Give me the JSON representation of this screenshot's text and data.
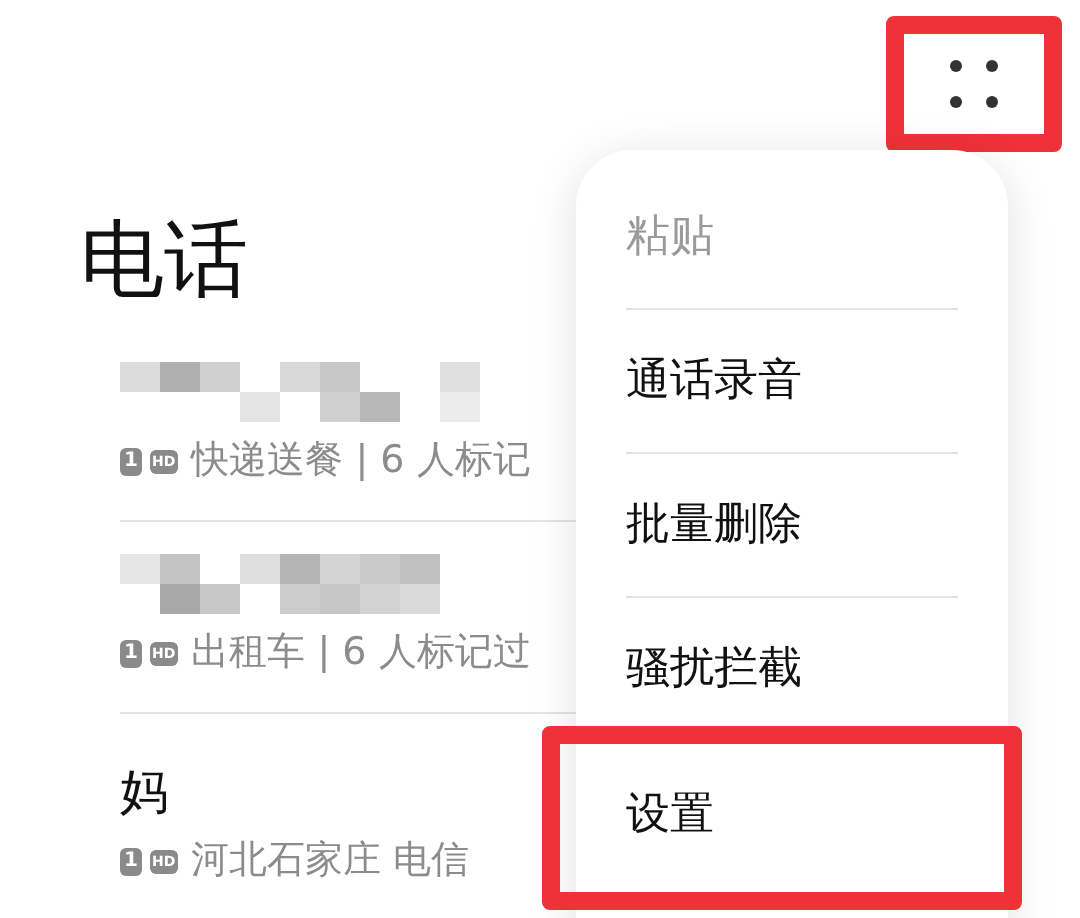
{
  "title": "电话",
  "calls": [
    {
      "kind": "hidden",
      "sim": "1",
      "badge": "HD",
      "detail": "快递送餐 | 6 人标记"
    },
    {
      "kind": "hidden",
      "sim": "1",
      "badge": "HD",
      "detail": "出租车 | 6 人标记过"
    },
    {
      "kind": "named",
      "name": "妈",
      "sim": "1",
      "badge": "HD",
      "detail": "河北石家庄 电信"
    }
  ],
  "menu": {
    "items": [
      {
        "label": "粘贴",
        "disabled": true,
        "highlighted": false
      },
      {
        "label": "通话录音",
        "disabled": false,
        "highlighted": false
      },
      {
        "label": "批量删除",
        "disabled": false,
        "highlighted": false
      },
      {
        "label": "骚扰拦截",
        "disabled": false,
        "highlighted": false
      },
      {
        "label": "设置",
        "disabled": false,
        "highlighted": true
      }
    ]
  },
  "more_button": {
    "highlighted": true
  }
}
